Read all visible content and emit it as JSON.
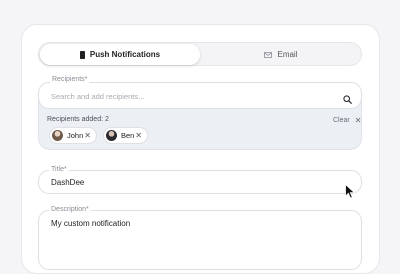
{
  "tabs": [
    {
      "label": "Push Notifications",
      "icon": "phone-icon",
      "active": true
    },
    {
      "label": "Email",
      "icon": "mail-icon",
      "active": false
    }
  ],
  "recipients": {
    "label": "Recipients*",
    "placeholder": "Search and add recipients...",
    "added_label": "Recipients added: 2",
    "clear_label": "Clear",
    "chips": [
      {
        "name": "John"
      },
      {
        "name": "Ben"
      }
    ]
  },
  "title_field": {
    "label": "Title*",
    "value": "DashDee"
  },
  "description_field": {
    "label": "Description*",
    "value": "My custom notification"
  },
  "colors": {
    "background": "#f5f5f7",
    "panel": "#ffffff",
    "recipients_group": "#eceff4",
    "text": "#1f2024",
    "muted": "#8a8c94"
  }
}
